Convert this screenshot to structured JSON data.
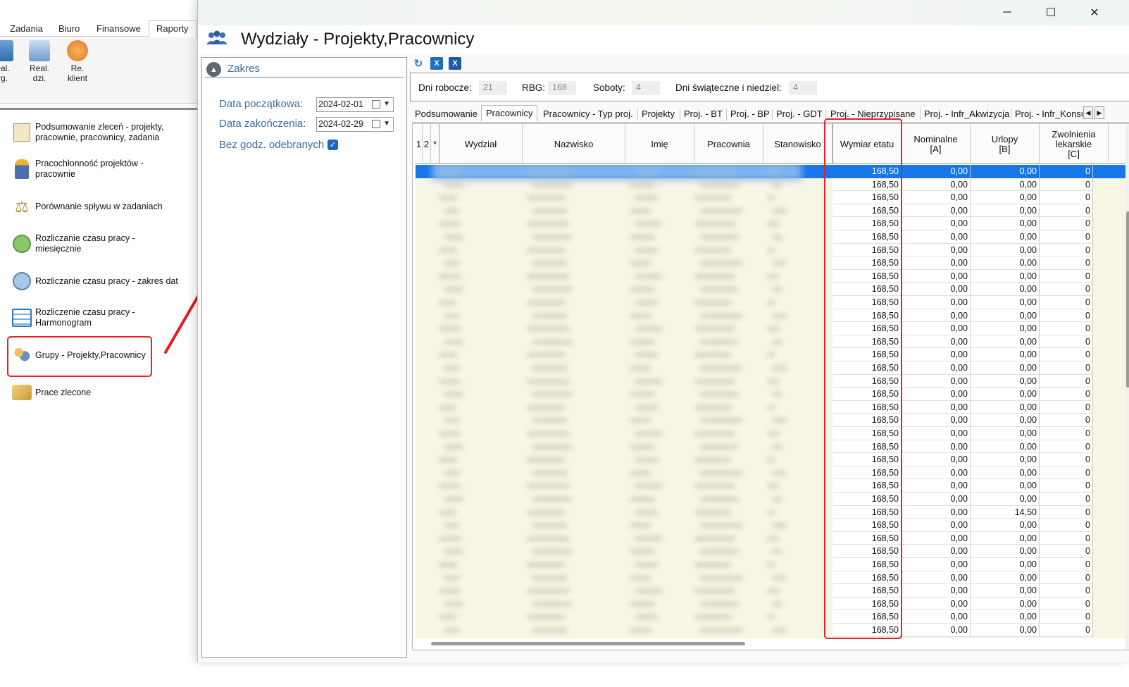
{
  "bg_app": {
    "menu": [
      "Zadania",
      "Biuro",
      "Finansowe",
      "Raporty"
    ],
    "ribbon": [
      {
        "label_line1": "eal.",
        "label_line2": "rg."
      },
      {
        "label_line1": "Real.",
        "label_line2": "dzi."
      },
      {
        "label_line1": "Re.",
        "label_line2": "klient"
      }
    ],
    "reports": [
      {
        "line1": "Podsumowanie zleceń - projekty,",
        "line2": "pracownie, pracownicy, zadania"
      },
      {
        "line1": "Pracochłonność projektów -",
        "line2": "pracownie"
      },
      {
        "line1": "Porównanie spływu w zadaniach",
        "line2": ""
      },
      {
        "line1": "Rozliczanie czasu pracy -",
        "line2": "miesięcznie"
      },
      {
        "line1": "Rozliczanie czasu pracy - zakres dat",
        "line2": ""
      },
      {
        "line1": "Rozliczenie czasu pracy -",
        "line2": "Harmonogram"
      },
      {
        "line1": "Grupy - Projekty,Pracownicy",
        "line2": ""
      },
      {
        "line1": "Prace zlecone",
        "line2": ""
      }
    ]
  },
  "window": {
    "controls": {
      "minimize": "─",
      "maximize": "☐",
      "close": "✕"
    },
    "title": "Wydziały - Projekty,Pracownicy"
  },
  "filter": {
    "section": "Zakres",
    "date_from_label": "Data początkowa:",
    "date_from": "2024-02-01",
    "date_to_label": "Data zakończenia:",
    "date_to": "2024-02-29",
    "bez_label": "Bez godz. odebranych",
    "bez_checked": true
  },
  "stats": {
    "dni_robocze_label": "Dni robocze:",
    "dni_robocze": "21",
    "rbg_label": "RBG:",
    "rbg": "168",
    "soboty_label": "Soboty:",
    "soboty": "4",
    "swieta_label": "Dni świąteczne i niedziel:",
    "swieta": "4"
  },
  "tabs": [
    "Podsumowanie",
    "Pracownicy",
    "Pracownicy - Typ proj.",
    "Projekty",
    "Proj. - BT",
    "Proj. - BP",
    "Proj. - GDT",
    "Proj. - Nieprzypisane",
    "Proj. - Infr_Akwizycja",
    "Proj. - Infr_Konsu"
  ],
  "active_tab": "Pracownicy",
  "grid": {
    "headers": {
      "c1": "1",
      "c2": "2",
      "c3": "*",
      "wydzial": "Wydział",
      "nazwisko": "Nazwisko",
      "imie": "Imię",
      "pracownia": "Pracownia",
      "stanowisko": "Stanowisko",
      "wymiar": "Wymiar etatu",
      "nominalne_1": "Nominalne",
      "nominalne_2": "[A]",
      "urlopy_1": "Urlopy",
      "urlopy_2": "[B]",
      "zwolnienia_1": "Zwolnienia",
      "zwolnienia_2": "lekarskie",
      "zwolnienia_3": "[C]"
    },
    "rows": [
      [
        "168,50",
        "0,00",
        "0,00",
        "0"
      ],
      [
        "168,50",
        "0,00",
        "0,00",
        "0"
      ],
      [
        "168,50",
        "0,00",
        "0,00",
        "0"
      ],
      [
        "168,50",
        "0,00",
        "0,00",
        "0"
      ],
      [
        "168,50",
        "0,00",
        "0,00",
        "0"
      ],
      [
        "168,50",
        "0,00",
        "0,00",
        "0"
      ],
      [
        "168,50",
        "0,00",
        "0,00",
        "0"
      ],
      [
        "168,50",
        "0,00",
        "0,00",
        "0"
      ],
      [
        "168,50",
        "0,00",
        "0,00",
        "0"
      ],
      [
        "168,50",
        "0,00",
        "0,00",
        "0"
      ],
      [
        "168,50",
        "0,00",
        "0,00",
        "0"
      ],
      [
        "168,50",
        "0,00",
        "0,00",
        "0"
      ],
      [
        "168,50",
        "0,00",
        "0,00",
        "0"
      ],
      [
        "168,50",
        "0,00",
        "0,00",
        "0"
      ],
      [
        "168,50",
        "0,00",
        "0,00",
        "0"
      ],
      [
        "168,50",
        "0,00",
        "0,00",
        "0"
      ],
      [
        "168,50",
        "0,00",
        "0,00",
        "0"
      ],
      [
        "168,50",
        "0,00",
        "0,00",
        "0"
      ],
      [
        "168,50",
        "0,00",
        "0,00",
        "0"
      ],
      [
        "168,50",
        "0,00",
        "0,00",
        "0"
      ],
      [
        "168,50",
        "0,00",
        "0,00",
        "0"
      ],
      [
        "168,50",
        "0,00",
        "0,00",
        "0"
      ],
      [
        "168,50",
        "0,00",
        "0,00",
        "0"
      ],
      [
        "168,50",
        "0,00",
        "0,00",
        "0"
      ],
      [
        "168,50",
        "0,00",
        "0,00",
        "0"
      ],
      [
        "168,50",
        "0,00",
        "0,00",
        "0"
      ],
      [
        "168,50",
        "0,00",
        "14,50",
        "0"
      ],
      [
        "168,50",
        "0,00",
        "0,00",
        "0"
      ],
      [
        "168,50",
        "0,00",
        "0,00",
        "0"
      ],
      [
        "168,50",
        "0,00",
        "0,00",
        "0"
      ],
      [
        "168,50",
        "0,00",
        "0,00",
        "0"
      ],
      [
        "168,50",
        "0,00",
        "0,00",
        "0"
      ],
      [
        "168,50",
        "0,00",
        "0,00",
        "0"
      ],
      [
        "168,50",
        "0,00",
        "0,00",
        "0"
      ],
      [
        "168,50",
        "0,00",
        "0,00",
        "0"
      ],
      [
        "168,50",
        "0,00",
        "0,00",
        "0"
      ]
    ]
  },
  "colors": {
    "accent": "#1877e8",
    "highlight": "#e0242a",
    "label_blue": "#3b6ea8",
    "row_bg": "#f7f6e4"
  }
}
